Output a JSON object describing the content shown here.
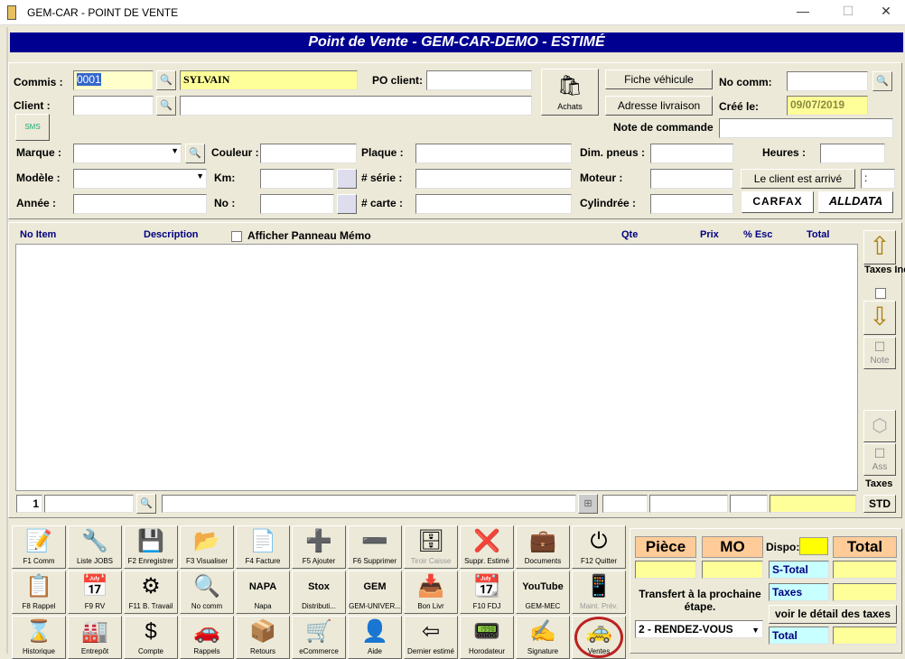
{
  "window": {
    "title": "GEM-CAR - POINT DE VENTE",
    "min": "—",
    "max": "☐",
    "close": "✕"
  },
  "banner": "Point de Vente - GEM-CAR-DEMO - ESTIMÉ",
  "header": {
    "commis_label": "Commis :",
    "commis_code": "0001",
    "commis_name": "SYLVAIN",
    "po_label": "PO client:",
    "po_value": "",
    "achats_label": "Achats",
    "fiche_label": "Fiche véhicule",
    "adresse_label": "Adresse livraison",
    "nocomm_label": "No comm:",
    "nocomm_value": "",
    "cree_label": "Créé le:",
    "cree_value": "09/07/2019",
    "note_label": "Note de commande",
    "note_value": "",
    "client_label": "Client :",
    "client_code": "",
    "client_name": "",
    "sms_label": "SMS"
  },
  "vehicle": {
    "marque": "Marque :",
    "couleur": "Couleur :",
    "plaque": "Plaque :",
    "dim": "Dim. pneus :",
    "heures": "Heures :",
    "modele": "Modèle :",
    "km": "Km:",
    "serie": "# série :",
    "moteur": "Moteur :",
    "arrive": "Le client est arrivé",
    "arrive_val": ":",
    "annee": "Année :",
    "no": "No :",
    "carte": "# carte :",
    "cylindree": "Cylindrée :",
    "carfax": "CARFAX",
    "alldata": "ALLDATA"
  },
  "table": {
    "no_item": "No Item",
    "description": "Description",
    "memo": "Afficher Panneau Mémo",
    "qte": "Qte",
    "prix": "Prix",
    "esc": "% Esc",
    "total": "Total"
  },
  "side": {
    "taxes_incl": "Taxes Incl.",
    "note": "Note",
    "ass": "Ass",
    "taxes": "Taxes",
    "std": "STD"
  },
  "entry": {
    "line": "1"
  },
  "toolbar": [
    [
      {
        "l": "F1 Comm",
        "i": "📝"
      },
      {
        "l": "Liste JOBS",
        "i": "🔧"
      },
      {
        "l": "F2 Enregistrer",
        "i": "💾"
      },
      {
        "l": "F3 Visualiser",
        "i": "📂"
      },
      {
        "l": "F4 Facture",
        "i": "📄"
      },
      {
        "l": "F5 Ajouter",
        "i": "➕"
      },
      {
        "l": "F6 Supprimer",
        "i": "➖"
      },
      {
        "l": "Tiroir Caisse",
        "i": "🗄",
        "g": true
      },
      {
        "l": "Suppr. Estimé",
        "i": "❌"
      },
      {
        "l": "Documents",
        "i": "💼"
      },
      {
        "l": "F12 Quitter",
        "i": "⏻"
      }
    ],
    [
      {
        "l": "F8 Rappel",
        "i": "📋"
      },
      {
        "l": "F9 RV",
        "i": "📅"
      },
      {
        "l": "F11 B. Travail",
        "i": "⚙"
      },
      {
        "l": "No comm",
        "i": "🔍"
      },
      {
        "l": "Napa",
        "i": "NAPA"
      },
      {
        "l": "Distributi...",
        "i": "Stox"
      },
      {
        "l": "GEM-UNIVER...",
        "i": "GEM"
      },
      {
        "l": "Bon Livr",
        "i": "📥"
      },
      {
        "l": "F10 FDJ",
        "i": "📆"
      },
      {
        "l": "GEM-MEC",
        "i": "YouTube"
      },
      {
        "l": "Maint. Prév.",
        "i": "📱",
        "g": true
      }
    ],
    [
      {
        "l": "Historique",
        "i": "⌛"
      },
      {
        "l": "Entrepôt",
        "i": "🏭"
      },
      {
        "l": "Compte",
        "i": "$"
      },
      {
        "l": "Rappels",
        "i": "🚗"
      },
      {
        "l": "Retours",
        "i": "📦"
      },
      {
        "l": "eCommerce",
        "i": "🛒"
      },
      {
        "l": "Aide",
        "i": "👤"
      },
      {
        "l": "Dernier estimé",
        "i": "⇦"
      },
      {
        "l": "Horodateur",
        "i": "📟"
      },
      {
        "l": "Signature",
        "i": "✍"
      },
      {
        "l": "Ventes",
        "i": "🚕"
      }
    ]
  ],
  "totals": {
    "piece": "Pièce",
    "mo": "MO",
    "dispo": "Dispo:",
    "total": "Total",
    "stotal": "S-Total",
    "taxes": "Taxes",
    "total2": "Total",
    "transfert": "Transfert à la prochaine étape.",
    "etape": "2 - RENDEZ-VOUS",
    "detail": "voir le détail des taxes"
  }
}
